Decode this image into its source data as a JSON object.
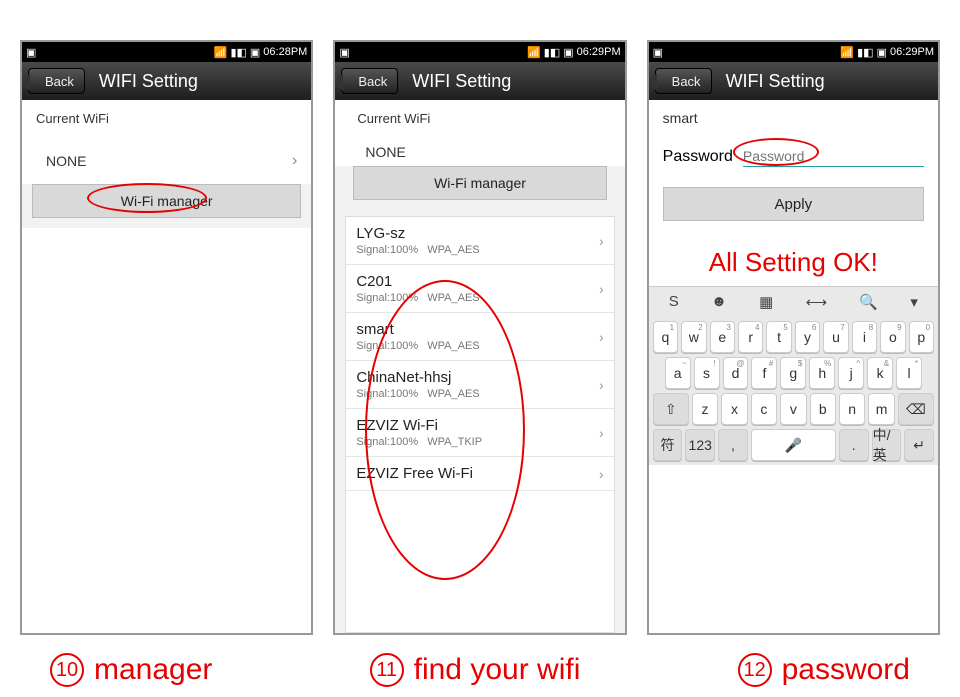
{
  "status": {
    "time1": "06:28PM",
    "time2": "06:29PM",
    "time3": "06:29PM"
  },
  "titlebar": {
    "back": "Back",
    "title": "WIFI Setting"
  },
  "panel1": {
    "current_label": "Current WiFi",
    "current_value": "NONE",
    "manager_btn": "Wi-Fi manager"
  },
  "panel2": {
    "current_label": "Current WiFi",
    "current_value": "NONE",
    "manager_btn": "Wi-Fi manager",
    "networks": [
      {
        "name": "LYG-sz",
        "signal": "Signal:100%",
        "sec": "WPA_AES"
      },
      {
        "name": "C201",
        "signal": "Signal:100%",
        "sec": "WPA_AES"
      },
      {
        "name": "smart",
        "signal": "Signal:100%",
        "sec": "WPA_AES"
      },
      {
        "name": "ChinaNet-hhsj",
        "signal": "Signal:100%",
        "sec": "WPA_AES"
      },
      {
        "name": "EZVIZ Wi-Fi",
        "signal": "Signal:100%",
        "sec": "WPA_TKIP"
      },
      {
        "name": "EZVIZ Free Wi-Fi",
        "signal": "",
        "sec": ""
      }
    ]
  },
  "panel3": {
    "ssid": "smart",
    "pw_label": "Password",
    "pw_placeholder": "Password",
    "apply": "Apply",
    "ok": "All Setting OK!"
  },
  "keyboard": {
    "row1": [
      "q",
      "w",
      "e",
      "r",
      "t",
      "y",
      "u",
      "i",
      "o",
      "p"
    ],
    "tops1": [
      "1",
      "2",
      "3",
      "4",
      "5",
      "6",
      "7",
      "8",
      "9",
      "0"
    ],
    "row2": [
      "a",
      "s",
      "d",
      "f",
      "g",
      "h",
      "j",
      "k",
      "l"
    ],
    "tops2": [
      "~",
      "!",
      "@",
      "#",
      "$",
      "%",
      "^",
      "&",
      "*"
    ],
    "row3": [
      "z",
      "x",
      "c",
      "v",
      "b",
      "n",
      "m"
    ],
    "shift": "⇧",
    "bksp": "⌫",
    "row4_sym": "符",
    "row4_num": "123",
    "row4_comma": ",",
    "row4_mic": "🎤",
    "row4_period": ".",
    "row4_lang": "中/英",
    "row4_enter": "↵"
  },
  "captions": {
    "n1": "10",
    "t1": "manager",
    "n2": "11",
    "t2": "find  your wifi",
    "n3": "12",
    "t3": "password"
  }
}
